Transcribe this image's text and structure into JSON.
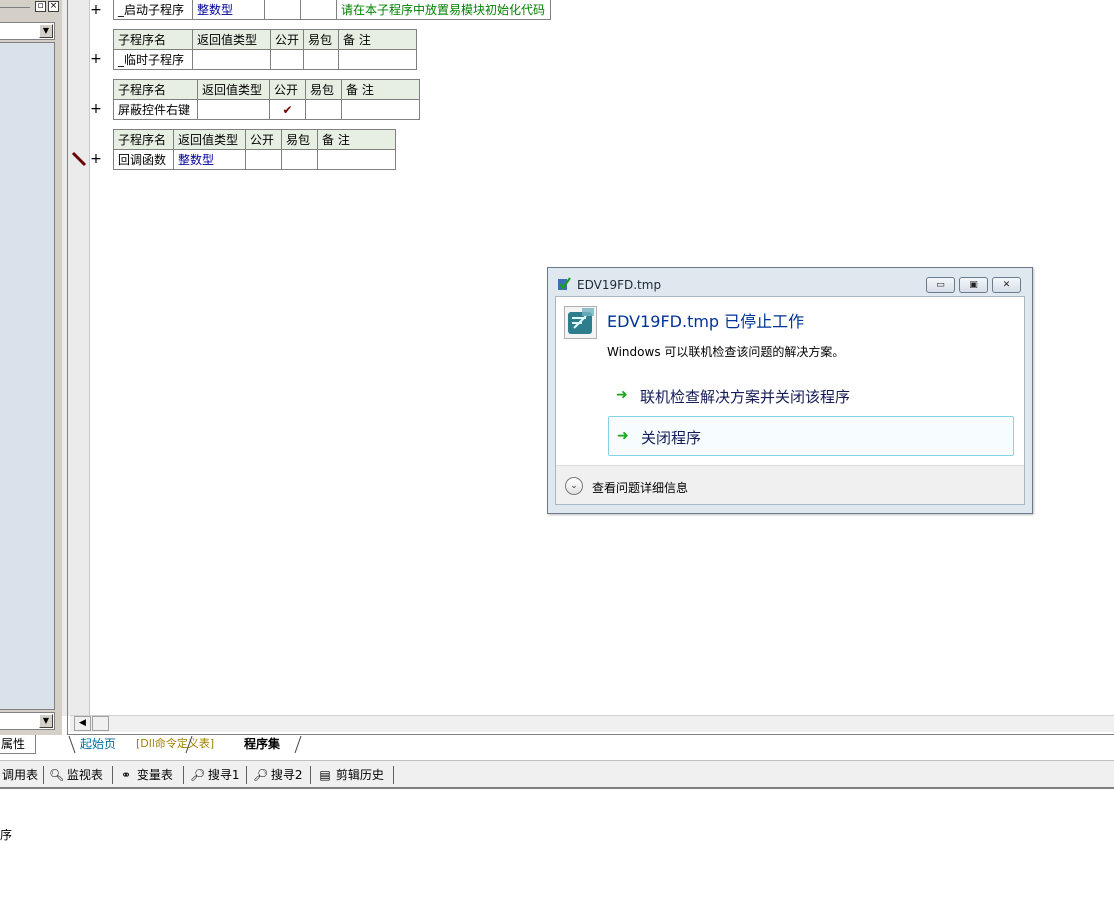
{
  "left_panel": {
    "minimize_glyph": "▫",
    "close_glyph": "×",
    "combo_arrow": "▼",
    "tab_label": "属性"
  },
  "editor": {
    "header": {
      "name": "子程序名",
      "return_type": "返回值类型",
      "public": "公开",
      "easy_pkg": "易包",
      "remark": "备 注"
    },
    "subs": [
      {
        "name": "_启动子程序",
        "return_type": "整数型",
        "public": "",
        "remark": "请在本子程序中放置易模块初始化代码"
      },
      {
        "name": "_临时子程序",
        "return_type": "",
        "public": "",
        "remark": ""
      },
      {
        "name": "屏蔽控件右键",
        "return_type": "",
        "public": "✔",
        "remark": ""
      },
      {
        "name": "回调函数",
        "return_type": "整数型",
        "public": "",
        "remark": ""
      }
    ],
    "plus": "+"
  },
  "doc_tabs": {
    "start_page": "起始页",
    "dll_defs": "[Dll命令定义表]",
    "program_set": "程序集"
  },
  "toolbar": {
    "call_table": "调用表",
    "watch": "监视表",
    "vars": "变量表",
    "search1": "搜寻1",
    "search2": "搜寻2",
    "clip_history": "剪辑历史"
  },
  "output_text": "序",
  "dialog": {
    "title": "EDV19FD.tmp",
    "heading": "EDV19FD.tmp 已停止工作",
    "description": "Windows 可以联机检查该问题的解决方案。",
    "option_online": "联机检查解决方案并关闭该程序",
    "option_close": "关闭程序",
    "details": "查看问题详细信息",
    "minimize_glyph": "▭",
    "restore_glyph": "▣",
    "close_glyph": "✕"
  },
  "colors": {
    "header_bg": "#e6efe2",
    "link_blue": "#00009a",
    "remark_green": "#008000",
    "dialog_heading": "#003399"
  }
}
